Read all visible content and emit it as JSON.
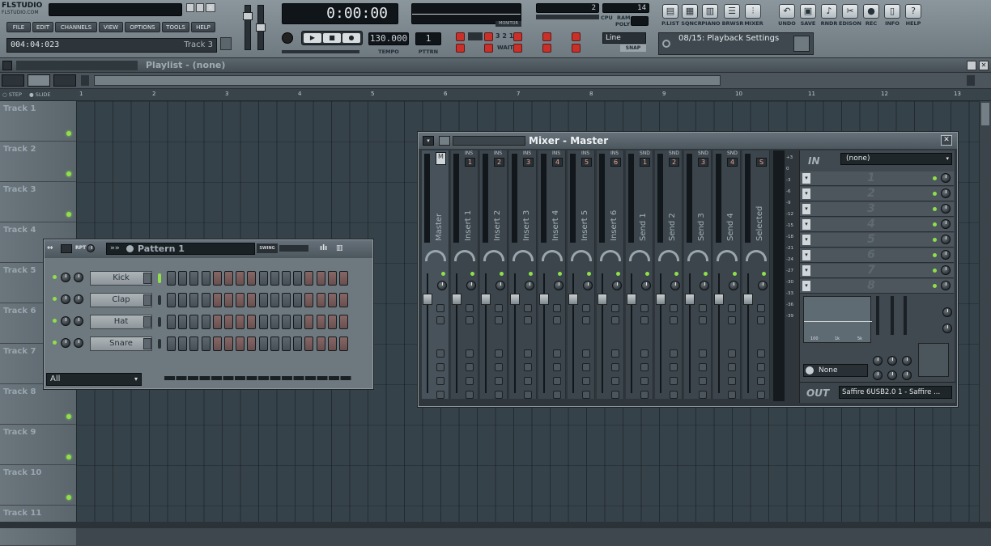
{
  "app": {
    "logo": "FLSTUDIO",
    "logo_sub": "FLSTUDIO.COM",
    "menu": [
      "FILE",
      "EDIT",
      "CHANNELS",
      "VIEW",
      "OPTIONS",
      "TOOLS",
      "HELP"
    ],
    "time_readout": "004:04:023",
    "current_track": "Track 3",
    "song_time": "0:00:00",
    "tempo_label": "TEMPO",
    "tempo_value": "130.000",
    "pattern_label": "PTTRN",
    "pattern_value": "1",
    "monitor_label": "MONITOR",
    "cpu_label": "CPU",
    "ram_label": "RAM",
    "poly_label": "POLY",
    "snap_label": "SNAP",
    "snap_value": "Line",
    "hint": "08/15: Playback Settings",
    "view_buttons": [
      "P.LIST",
      "SQNCR",
      "PIANO",
      "BRWSR",
      "MIXER"
    ],
    "tool_buttons": [
      "UNDO",
      "SAVE",
      "RNDR",
      "EDISON",
      "REC",
      "INFO",
      "HELP"
    ],
    "counter": {
      "a": "2",
      "b": "14"
    },
    "pat_ctr": "3 2 1",
    "wait_label": "WAIT"
  },
  "playlist": {
    "title": "Playlist - (none)",
    "step_label": "STEP",
    "slide_label": "SLIDE",
    "ruler": [
      "1",
      "2",
      "3",
      "4",
      "5",
      "6",
      "7",
      "8",
      "9",
      "10",
      "11",
      "12",
      "13"
    ],
    "tracks": [
      "Track 1",
      "Track 2",
      "Track 3",
      "Track 4",
      "Track 5",
      "Track 6",
      "Track 7",
      "Track 8",
      "Track 9",
      "Track 10",
      "Track 11"
    ]
  },
  "stepseq": {
    "pattern": "Pattern 1",
    "rpt": "RPT",
    "swing": "SWING",
    "channels": [
      "Kick",
      "Clap",
      "Hat",
      "Snare"
    ],
    "filter": "All"
  },
  "mixer": {
    "title": "Mixer - Master",
    "strips": [
      {
        "name": "Master",
        "hd": "",
        "num": "M"
      },
      {
        "name": "Insert 1",
        "hd": "INS",
        "num": "1"
      },
      {
        "name": "Insert 2",
        "hd": "INS",
        "num": "2"
      },
      {
        "name": "Insert 3",
        "hd": "INS",
        "num": "3"
      },
      {
        "name": "Insert 4",
        "hd": "INS",
        "num": "4"
      },
      {
        "name": "Insert 5",
        "hd": "INS",
        "num": "5"
      },
      {
        "name": "Insert 6",
        "hd": "INS",
        "num": "6"
      },
      {
        "name": "Send 1",
        "hd": "SND",
        "num": "1"
      },
      {
        "name": "Send 2",
        "hd": "SND",
        "num": "2"
      },
      {
        "name": "Send 3",
        "hd": "SND",
        "num": "3"
      },
      {
        "name": "Send 4",
        "hd": "SND",
        "num": "4"
      },
      {
        "name": "Selected",
        "hd": "",
        "num": "S"
      }
    ],
    "scale": [
      "+3",
      "0",
      "-3",
      "-6",
      "-9",
      "-12",
      "-15",
      "-18",
      "-21",
      "-24",
      "-27",
      "-30",
      "-33",
      "-36",
      "-39"
    ],
    "in_label": "IN",
    "in_value": "(none)",
    "slots": [
      "1",
      "2",
      "3",
      "4",
      "5",
      "6",
      "7",
      "8"
    ],
    "eq_labels": [
      "100",
      "1k",
      "5k"
    ],
    "none_label": "None",
    "out_label": "OUT",
    "out_value": "Saffire 6USB2.0 1 - Saffire ..."
  }
}
